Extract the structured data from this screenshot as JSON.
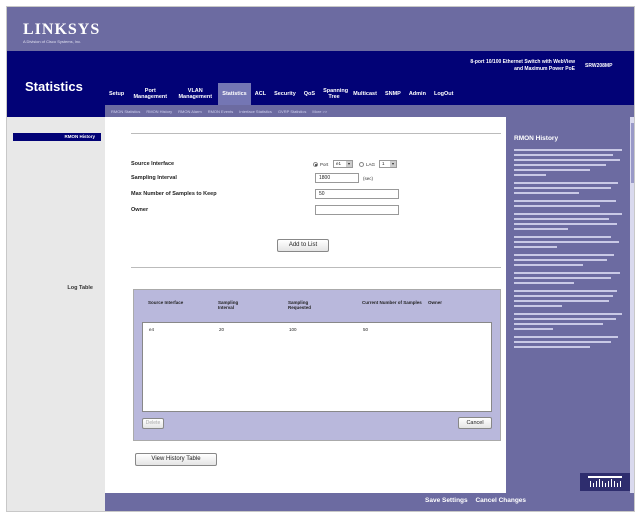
{
  "brand": {
    "logo": "LINKSYS",
    "tagline": "A Division of Cisco Systems, Inc."
  },
  "page_title": "Statistics",
  "product": {
    "line1": "8-port 10/100 Ethernet Switch with WebView",
    "line2": "and Maximum Power PoE",
    "model": "SRW208MP"
  },
  "tabs": [
    {
      "label": "Setup"
    },
    {
      "label": "Port Management"
    },
    {
      "label": "VLAN Management"
    },
    {
      "label": "Statistics",
      "active": true
    },
    {
      "label": "ACL"
    },
    {
      "label": "Security"
    },
    {
      "label": "QoS"
    },
    {
      "label": "Spanning Tree"
    },
    {
      "label": "Multicast"
    },
    {
      "label": "SNMP"
    },
    {
      "label": "Admin"
    },
    {
      "label": "LogOut"
    }
  ],
  "subtabs": [
    "RMON Statistics",
    "RMON History",
    "RMON Alarm",
    "RMON Events",
    "Interface Statistics",
    "GVRP Statistics",
    "More >>"
  ],
  "left": {
    "active_item": "RMON History",
    "log_table_label": "Log Table"
  },
  "form": {
    "source_interface_label": "Source Interface",
    "port_label": "Port",
    "port_value": "e1",
    "lag_label": "LAG",
    "lag_value": "1",
    "sampling_interval_label": "Sampling Interval",
    "sampling_interval_value": "1800",
    "sampling_interval_unit": "(sec)",
    "max_samples_label": "Max Number of Samples to Keep",
    "max_samples_value": "50",
    "owner_label": "Owner",
    "owner_value": "",
    "add_button": "Add to List"
  },
  "table": {
    "headers": [
      "Source Interface",
      "Sampling Interval",
      "Sampling Requested",
      "Current Number of Samples",
      "Owner"
    ],
    "rows": [
      {
        "source": "e4",
        "interval": "20",
        "requested": "100",
        "current": "50",
        "owner": ""
      }
    ],
    "delete_button": "Delete",
    "cancel_button": "Cancel"
  },
  "view_history_button": "View History Table",
  "help": {
    "title": "RMON History"
  },
  "footer": {
    "save": "Save Settings",
    "cancel": "Cancel Changes"
  }
}
